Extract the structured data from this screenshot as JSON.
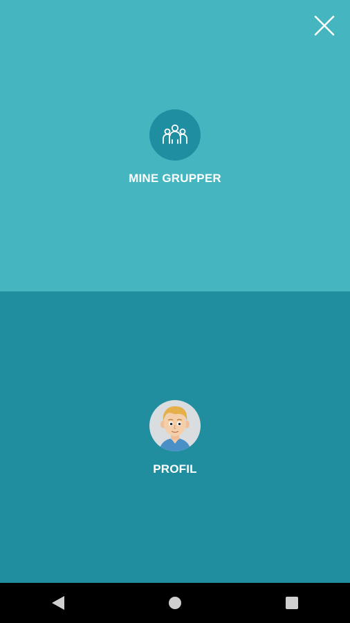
{
  "menu": {
    "groups": {
      "label": "MINE GRUPPER",
      "icon": "groups-icon"
    },
    "profile": {
      "label": "PROFIL",
      "icon": "avatar"
    }
  },
  "header": {
    "close_icon": "close-icon"
  },
  "navbar": {
    "back_icon": "back-icon",
    "home_icon": "home-icon",
    "recent_icon": "recent-apps-icon"
  },
  "colors": {
    "top_panel": "#45b6c0",
    "bottom_panel": "#218e9f",
    "groups_circle": "#1f8ea0",
    "navbar": "#000000"
  }
}
